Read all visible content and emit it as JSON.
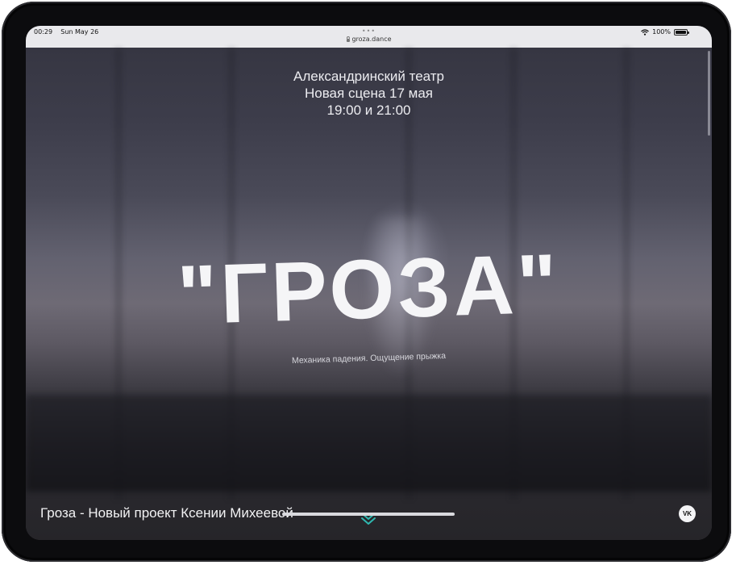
{
  "status_bar": {
    "time": "00:29",
    "date": "Sun May 26",
    "battery": "100%",
    "battery_level": 1.0
  },
  "browser": {
    "url": "groza.dance",
    "menu_dots": "•••"
  },
  "hero": {
    "venue_lines": [
      "Александринский театр",
      "Новая сцена 17 мая",
      "19:00 и 21:00"
    ],
    "title": "\"ГРОЗА\"",
    "subtitle": "Механика падения. Ощущение прыжка"
  },
  "footer": {
    "project_title": "Гроза - Новый проект Ксении Михеевой",
    "social_label": "VK",
    "scroll_icon": "chevron-double-down-icon"
  },
  "colors": {
    "scroll_icon": "#2fb8b0",
    "text": "#f2f2f4",
    "status_bar_bg": "#e9e9ec"
  }
}
